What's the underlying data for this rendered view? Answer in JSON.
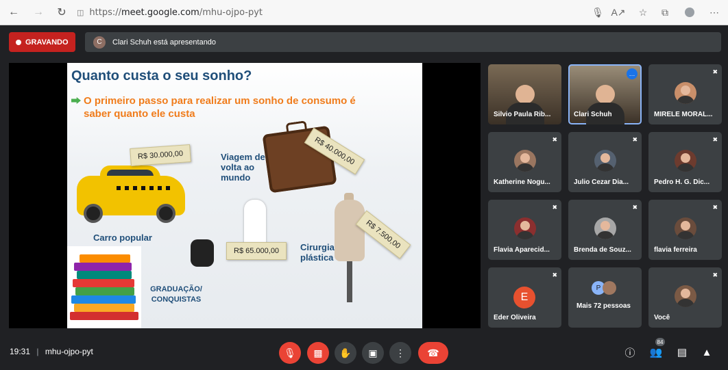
{
  "browser": {
    "url_prefix": "https://",
    "url_domain": "meet.google.com",
    "url_path": "/mhu-ojpo-pyt"
  },
  "meet": {
    "recording_label": "GRAVANDO",
    "presenter_initial": "C",
    "presenting_text": "Clari Schuh está apresentando"
  },
  "slide": {
    "title": "Quanto custa o seu sonho?",
    "subtitle": "O primeiro passo para realizar um sonho de consumo é saber quanto ele custa",
    "items": [
      {
        "label": "Carro popular",
        "price": "R$ 30.000,00"
      },
      {
        "label": "Viagem de volta ao mundo",
        "price": "R$ 40.000,00"
      },
      {
        "label": "",
        "price": "R$ 65.000,00"
      },
      {
        "label": "Cirurgia plástica",
        "price": "R$ 7.500,00"
      },
      {
        "label": "GRADUAÇÃO/ CONQUISTAS",
        "price": ""
      }
    ]
  },
  "participants": [
    {
      "name": "Silvio Paula Rib...",
      "initial": ""
    },
    {
      "name": "Clari Schuh",
      "initial": ""
    },
    {
      "name": "MIRELE MORAL...",
      "initial": ""
    },
    {
      "name": "Katherine Nogu...",
      "initial": ""
    },
    {
      "name": "Julio Cezar Dia...",
      "initial": ""
    },
    {
      "name": "Pedro H. G. Dic...",
      "initial": ""
    },
    {
      "name": "Flavia Aparecid...",
      "initial": ""
    },
    {
      "name": "Brenda de Souz...",
      "initial": ""
    },
    {
      "name": "flavia ferreira",
      "initial": ""
    },
    {
      "name": "Eder Oliveira",
      "initial": "E"
    },
    {
      "name": "Mais 72 pessoas",
      "initial": "P"
    },
    {
      "name": "Você",
      "initial": ""
    }
  ],
  "footer": {
    "time": "19:31",
    "separator": "|",
    "meeting_code": "mhu-ojpo-pyt",
    "people_count": "84"
  },
  "colors": {
    "recording": "#c5221f",
    "end_call": "#ea4335",
    "background": "#202124",
    "tile": "#3c4043"
  }
}
